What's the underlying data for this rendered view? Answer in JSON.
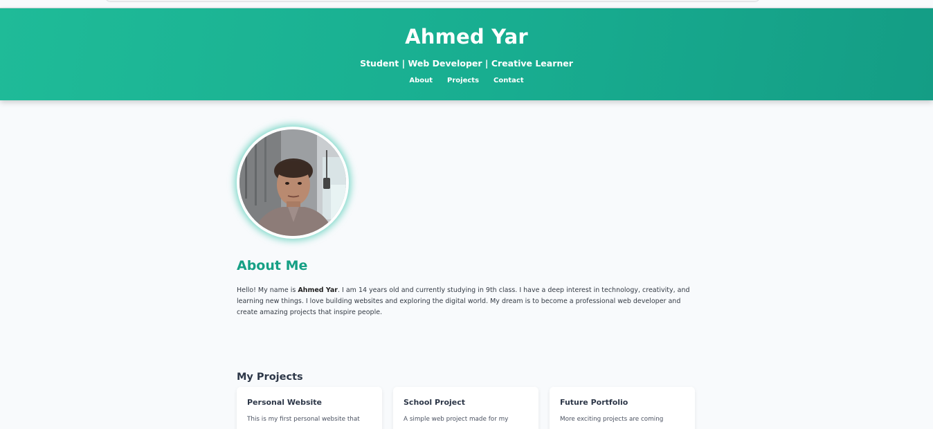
{
  "header": {
    "name": "Ahmed Yar",
    "tagline": "Student | Web Developer | Creative Learner",
    "nav": [
      "About",
      "Projects",
      "Contact"
    ]
  },
  "profile": {
    "photo_alt": "profile-photo"
  },
  "about": {
    "title": "About Me",
    "intro_before": "Hello! My name is ",
    "name_bold": "Ahmed Yar",
    "intro_after": ". I am 14 years old and currently studying in 9th class. I have a deep interest in technology, creativity, and learning new things. I love building websites and exploring the digital world. My dream is to become a professional web developer and create amazing projects that inspire people."
  },
  "projects": {
    "title": "My Projects",
    "cards": [
      {
        "title": "Personal Website",
        "text": "This is my first personal website that"
      },
      {
        "title": "School Project",
        "text": "A simple web project made for my"
      },
      {
        "title": "Future Portfolio",
        "text": "More exciting projects are coming"
      }
    ]
  },
  "colors": {
    "header_gradient_start": "#1fbb98",
    "header_gradient_end": "#149d85",
    "accent": "#16a085",
    "page_background": "#f8fafc"
  }
}
